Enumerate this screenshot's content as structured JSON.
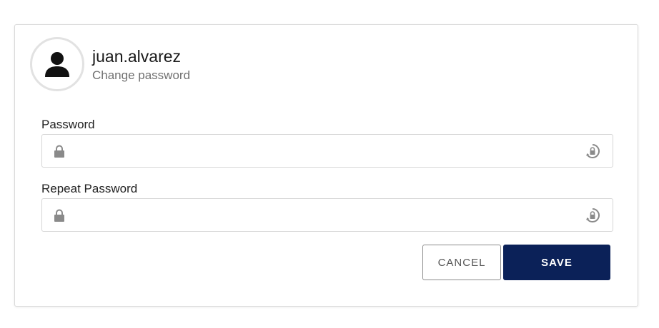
{
  "profile": {
    "username": "juan.alvarez",
    "subtitle": "Change password"
  },
  "form": {
    "password_label": "Password",
    "password_value": "",
    "repeat_label": "Repeat Password",
    "repeat_value": ""
  },
  "actions": {
    "cancel_label": "CANCEL",
    "save_label": "SAVE"
  },
  "icons": {
    "avatar": "user-icon",
    "field_prefix": "lock-icon",
    "field_suffix": "show-password-icon"
  },
  "colors": {
    "primary": "#0b2158",
    "border": "#d6d6d6",
    "icon": "#8a8a8a"
  }
}
